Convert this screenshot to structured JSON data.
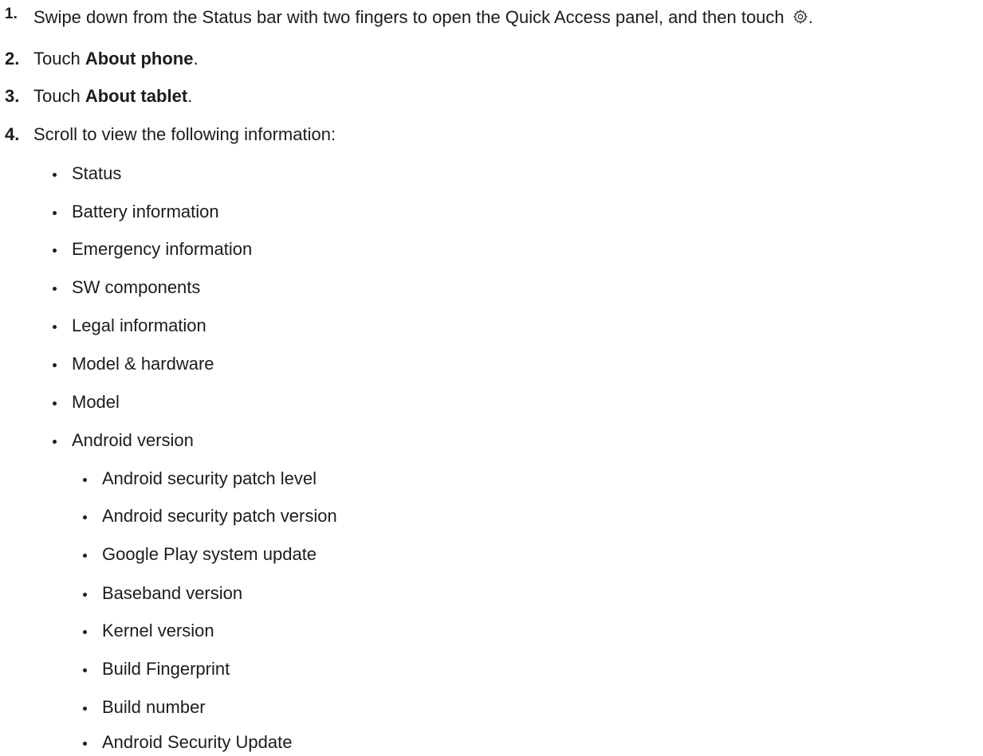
{
  "steps": [
    {
      "number": "1.",
      "text_before": "Swipe down from the Status bar with two fingers to open the Quick Access panel, and then touch",
      "icon": "gear-icon",
      "text_after": "."
    },
    {
      "number": "2.",
      "prefix": "Touch ",
      "bold": "About phone",
      "suffix": "."
    },
    {
      "number": "3.",
      "prefix": "Touch ",
      "bold": "About tablet",
      "suffix": "."
    },
    {
      "number": "4.",
      "text": "Scroll to view the following information:"
    }
  ],
  "info_items": [
    "Status",
    "Battery information",
    "Emergency information",
    "SW components",
    "Legal information",
    "Model & hardware",
    "Model",
    "Android version"
  ],
  "android_version_items": [
    "Android security patch level",
    "Android security patch version",
    "Google Play system update",
    "Baseband version",
    "Kernel version",
    "Build Fingerprint",
    "Build number",
    "Android Security Update"
  ]
}
